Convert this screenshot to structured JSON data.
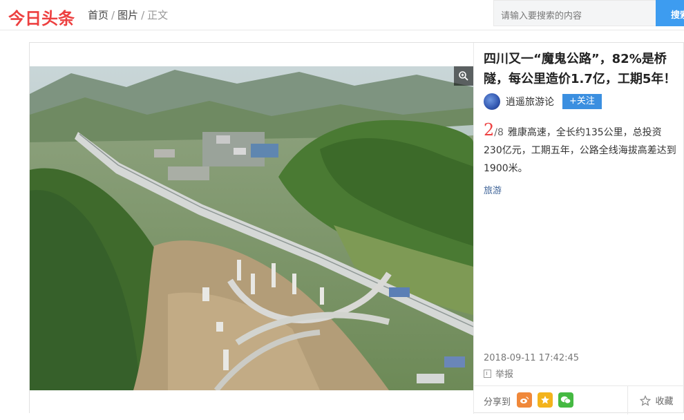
{
  "header": {
    "logo": "今日头条",
    "breadcrumb": {
      "home": "首页",
      "sep1": "/",
      "pictures": "图片",
      "sep2": "/",
      "current": "正文"
    },
    "search": {
      "placeholder": "请输入要搜索的内容",
      "button_label": "搜索"
    }
  },
  "article": {
    "title": "四川又一“魔鬼公路”，82%是桥隧，每公里造价1.7亿，工期5年！",
    "author": "逍遥旅游论",
    "follow_label": "+关注",
    "photo_index": "2",
    "photo_total": "/8",
    "caption": "雅康高速，全长约135公里，总投资230亿元，工期五年，公路全线海拔高差达到1900米。",
    "tag": "旅游",
    "timestamp": "2018-09-11 17:42:45",
    "report_label": "举报",
    "share_label": "分享到",
    "favorite_label": "收藏"
  },
  "icons": {
    "zoom": "zoom-in-icon",
    "weibo": "weibo-icon",
    "qzone": "qzone-star-icon",
    "wechat": "wechat-icon",
    "favorite": "star-outline-icon",
    "report": "report-icon"
  },
  "colors": {
    "brand_red": "#ed4040",
    "follow_blue": "#3b8fe0",
    "search_blue": "#3d9cf0",
    "tag_blue": "#406599"
  }
}
